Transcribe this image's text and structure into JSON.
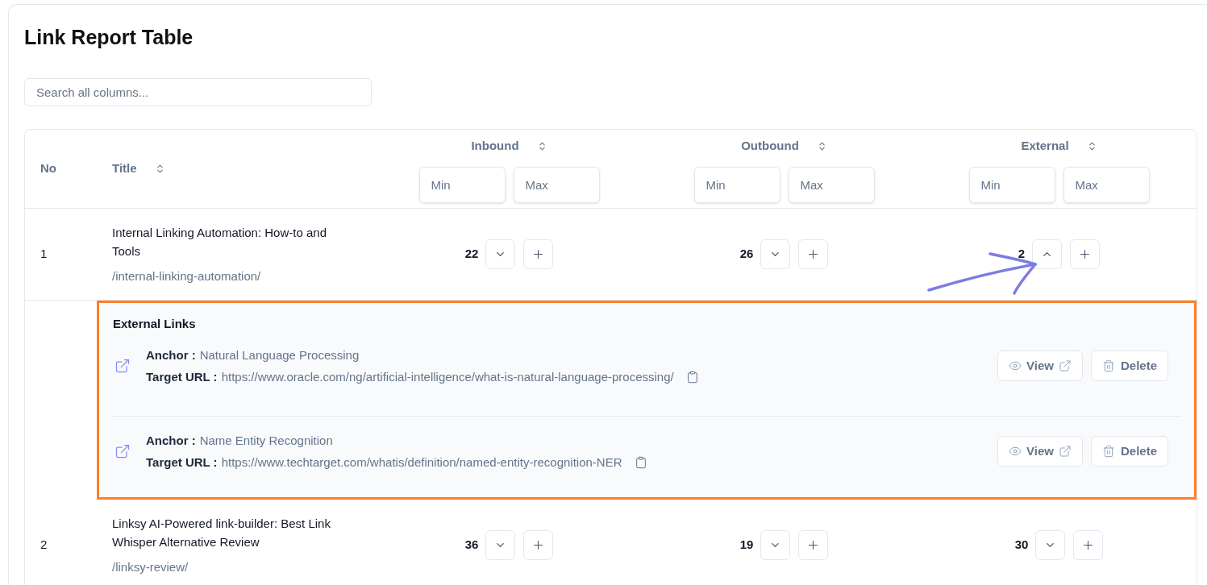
{
  "page": {
    "title": "Link Report Table"
  },
  "search": {
    "placeholder": "Search all columns..."
  },
  "table": {
    "columns": [
      {
        "kind": "text",
        "label": "No",
        "sortable": false
      },
      {
        "kind": "text",
        "label": "Title",
        "sortable": true
      },
      {
        "kind": "count",
        "label": "Inbound",
        "sortable": true,
        "min_placeholder": "Min",
        "max_placeholder": "Max"
      },
      {
        "kind": "count",
        "label": "Outbound",
        "sortable": true,
        "min_placeholder": "Min",
        "max_placeholder": "Max"
      },
      {
        "kind": "count",
        "label": "External",
        "sortable": true,
        "min_placeholder": "Min",
        "max_placeholder": "Max"
      }
    ],
    "rows": [
      {
        "no": "1",
        "title": "Internal Linking Automation: How-to and Tools",
        "slug": "/internal-linking-automation/",
        "counts": [
          {
            "value": "22",
            "expanded": false
          },
          {
            "value": "26",
            "expanded": false
          },
          {
            "value": "2",
            "expanded": true
          }
        ],
        "details": {
          "highlighted": true,
          "heading": "External Links",
          "links": [
            {
              "anchor_label": "Anchor :",
              "anchor": "Natural Language Processing",
              "url_label": "Target URL :",
              "url": "https://www.oracle.com/ng/artificial-intelligence/what-is-natural-language-processing/",
              "view": "View",
              "delete": "Delete"
            },
            {
              "anchor_label": "Anchor :",
              "anchor": "Name Entity Recognition",
              "url_label": "Target URL :",
              "url": "https://www.techtarget.com/whatis/definition/named-entity-recognition-NER",
              "view": "View",
              "delete": "Delete"
            }
          ]
        }
      },
      {
        "no": "2",
        "title": "Linksy AI-Powered link-builder: Best Link Whisper Alternative Review",
        "slug": "/linksy-review/",
        "counts": [
          {
            "value": "36",
            "expanded": false
          },
          {
            "value": "19",
            "expanded": false
          },
          {
            "value": "30",
            "expanded": false
          }
        ]
      }
    ]
  }
}
